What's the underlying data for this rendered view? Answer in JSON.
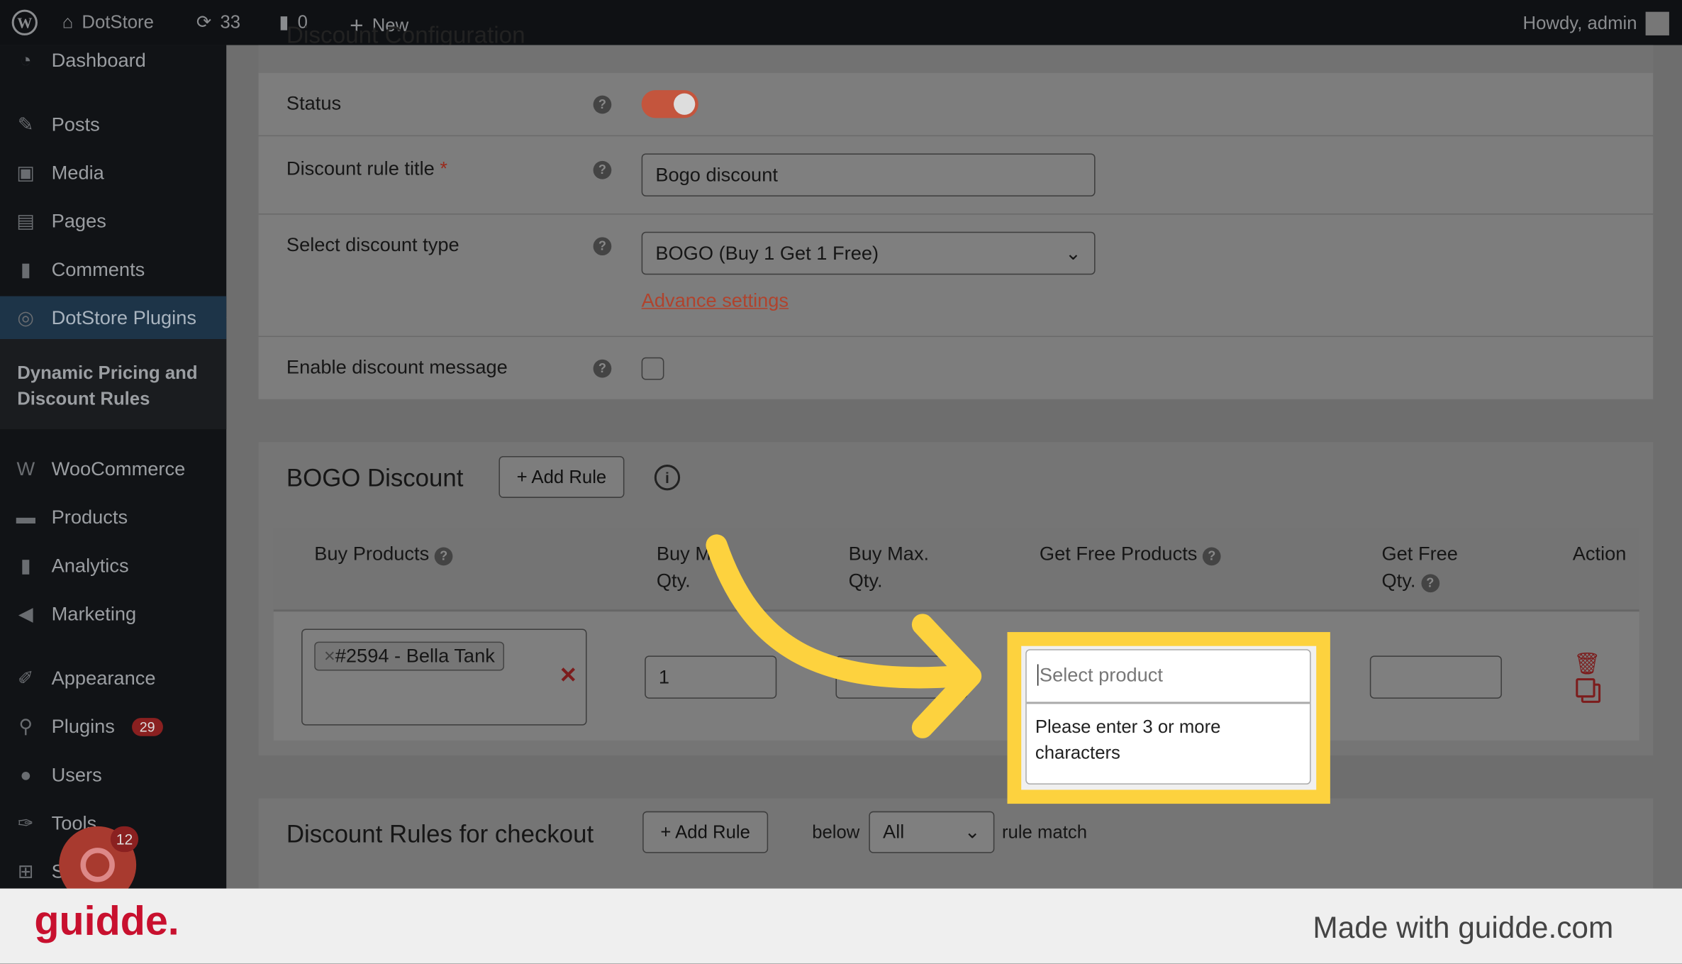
{
  "topbar": {
    "site": "DotStore",
    "updates": "33",
    "comments": "0",
    "new": "New",
    "howdy": "Howdy, admin"
  },
  "sidebar": {
    "items": [
      {
        "label": "Dashboard",
        "icon": "dashboard-icon"
      },
      {
        "label": "Posts",
        "icon": "pin-icon"
      },
      {
        "label": "Media",
        "icon": "media-icon"
      },
      {
        "label": "Pages",
        "icon": "pages-icon"
      },
      {
        "label": "Comments",
        "icon": "comment-icon"
      },
      {
        "label": "DotStore Plugins",
        "icon": "dotstore-icon"
      },
      {
        "label": "WooCommerce",
        "icon": "woo-icon"
      },
      {
        "label": "Products",
        "icon": "products-icon"
      },
      {
        "label": "Analytics",
        "icon": "analytics-icon"
      },
      {
        "label": "Marketing",
        "icon": "megaphone-icon"
      },
      {
        "label": "Appearance",
        "icon": "brush-icon"
      },
      {
        "label": "Plugins",
        "icon": "plugin-icon",
        "badge": "29"
      },
      {
        "label": "Users",
        "icon": "users-icon"
      },
      {
        "label": "Tools",
        "icon": "wrench-icon"
      },
      {
        "label": "S",
        "icon": "settings-icon"
      }
    ],
    "submenu": "Dynamic Pricing and Discount Rules",
    "recorder_badge": "12"
  },
  "config": {
    "heading": "Discount Configuration",
    "status_label": "Status",
    "status_on": true,
    "title_label": "Discount rule title",
    "required": "*",
    "title_value": "Bogo discount",
    "type_label": "Select discount type",
    "type_value": "BOGO (Buy 1 Get 1 Free)",
    "advance": "Advance settings",
    "message_label": "Enable discount message"
  },
  "bogo": {
    "heading": "BOGO Discount",
    "add_rule": "+ Add Rule",
    "columns": [
      "Buy Products",
      "Buy Min. Qty.",
      "Buy Max. Qty.",
      "Get Free Products",
      "Get Free Qty.",
      "Action"
    ],
    "row": {
      "buy_product_tag": "#2594 - Bella Tank",
      "buy_min": "1",
      "buy_max": "",
      "get_free_qty": ""
    },
    "dropdown": {
      "placeholder": "Select product",
      "message": "Please enter 3 or more characters"
    }
  },
  "checkout": {
    "heading": "Discount Rules for checkout",
    "add_rule": "+ Add Rule",
    "below": "below",
    "select": "All",
    "rule_match": "rule match"
  },
  "footer": {
    "logo": "guidde.",
    "made_with": "Made with guidde.com"
  },
  "colors": {
    "highlight": "#fdd23e",
    "logo": "#c8102e",
    "toggle": "#c4553d"
  }
}
